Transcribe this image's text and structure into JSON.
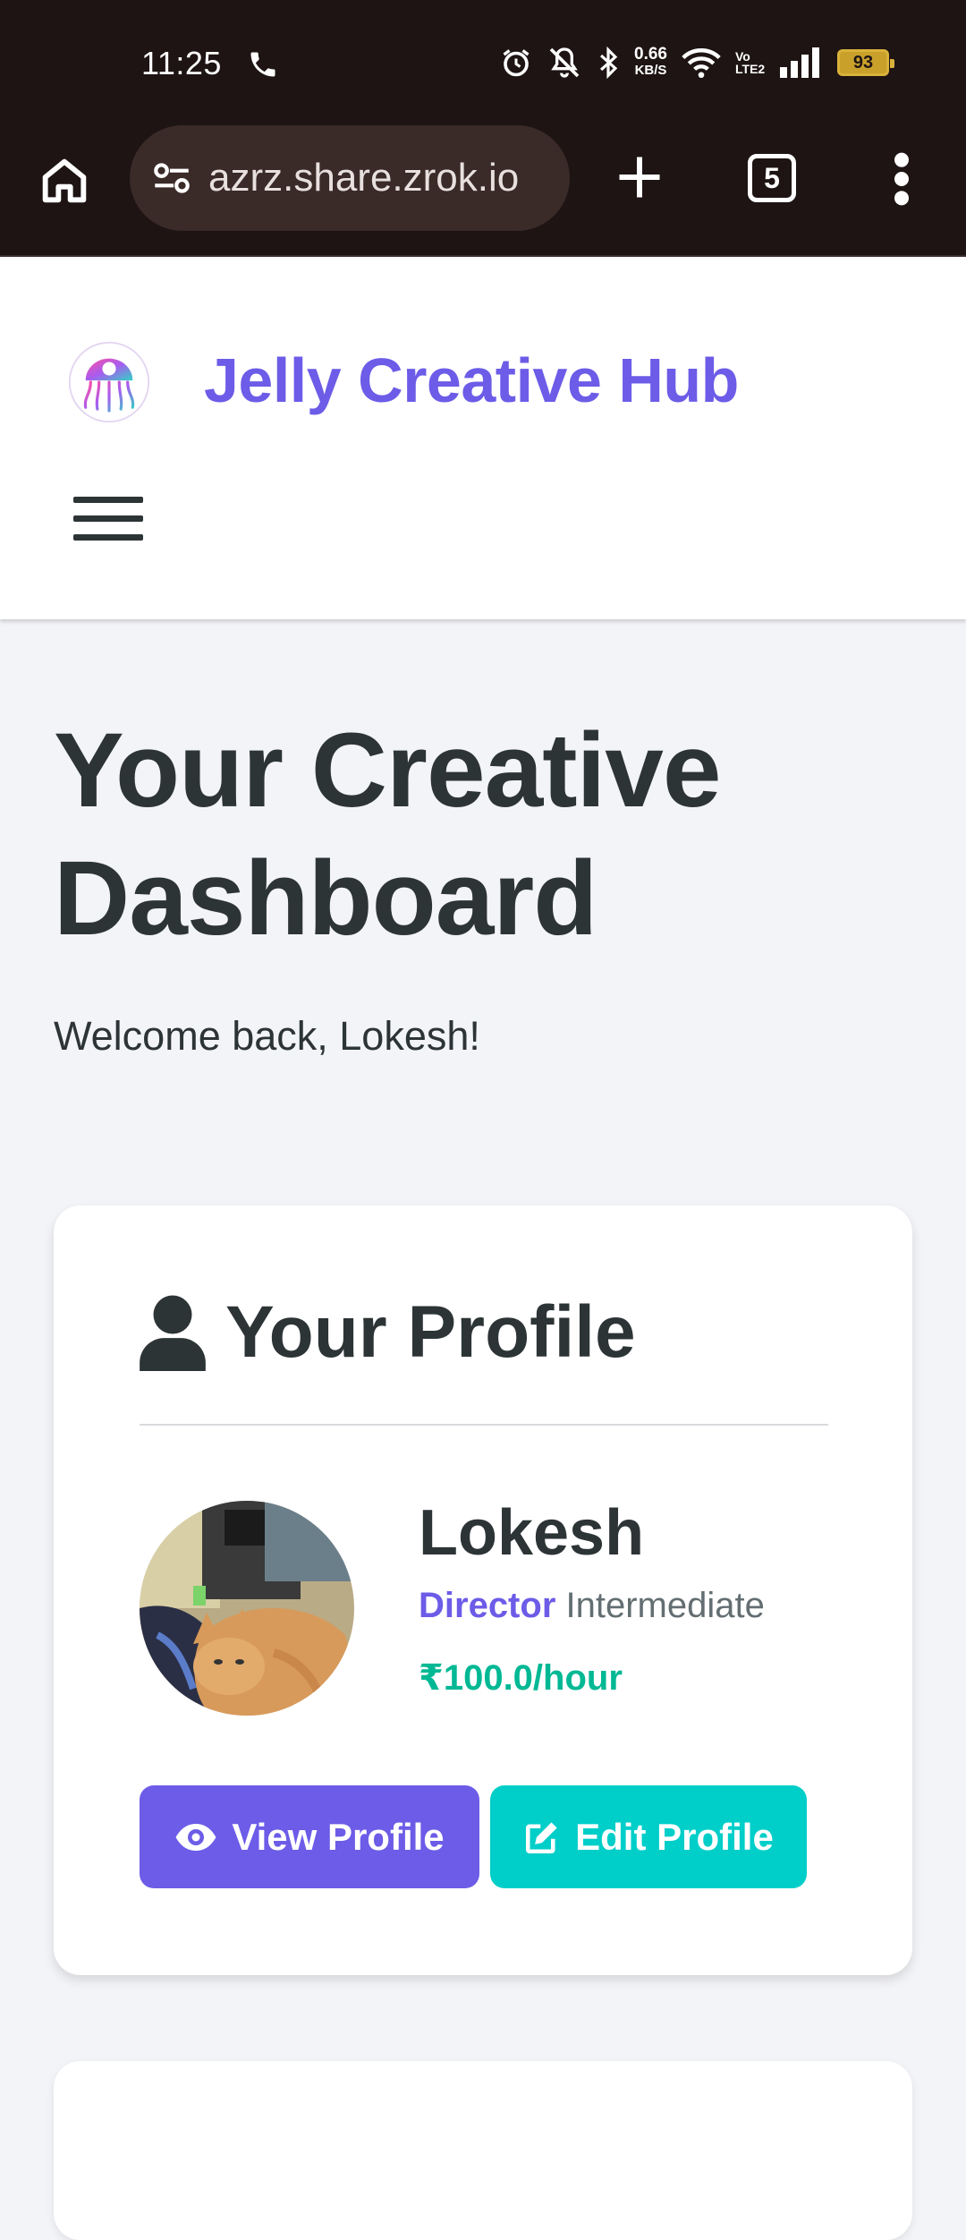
{
  "status_bar": {
    "time": "11:25",
    "net_speed_value": "0.66",
    "net_speed_unit": "KB/S",
    "volte_label": "Vo LTE2",
    "battery_level": "93",
    "icons": [
      "call-icon",
      "alarm-icon",
      "mute-icon",
      "bluetooth-icon",
      "wifi-icon",
      "signal-icon",
      "battery-icon"
    ]
  },
  "browser": {
    "url": "azrz.share.zrok.io",
    "tab_count": "5",
    "icons": [
      "home-icon",
      "site-settings-icon",
      "plus-icon",
      "more-vert-icon"
    ]
  },
  "header": {
    "brand": "Jelly Creative Hub",
    "icons": [
      "jellyfish-logo",
      "hamburger-menu-icon"
    ]
  },
  "main": {
    "title": "Your Creative Dashboard",
    "welcome": "Welcome back, Lokesh!"
  },
  "profile_card": {
    "heading": "Your Profile",
    "name": "Lokesh",
    "role": "Director",
    "level": "Intermediate",
    "rate": "₹100.0/hour",
    "view_button": "View Profile",
    "edit_button": "Edit Profile",
    "icons": [
      "user-icon",
      "eye-icon",
      "edit-icon"
    ]
  },
  "colors": {
    "primary": "#6c5ce7",
    "secondary": "#00cec9",
    "success": "#00b894",
    "text": "#2d3436",
    "background": "#f3f4f8",
    "browser_bar": "#1e1414"
  }
}
